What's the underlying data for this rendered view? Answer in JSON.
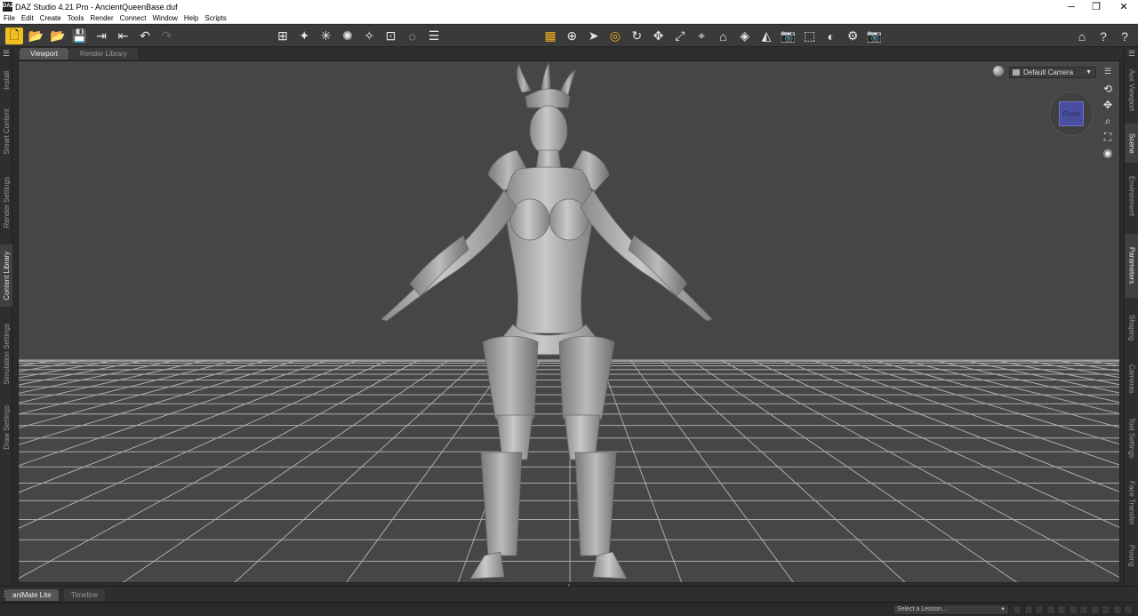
{
  "window": {
    "title": "DAZ Studio 4.21 Pro - AncientQueenBase.duf",
    "app_icon": "DAZ",
    "minimize": "─",
    "restore": "❐",
    "close": "✕"
  },
  "menu": [
    "File",
    "Edit",
    "Create",
    "Tools",
    "Render",
    "Connect",
    "Window",
    "Help",
    "Scripts"
  ],
  "toolbar": {
    "file_tools": [
      {
        "icon": "new-file-icon",
        "glyph": "🗋"
      },
      {
        "icon": "open-folder-icon",
        "glyph": "📂"
      },
      {
        "icon": "merge-folder-icon",
        "glyph": "📂"
      },
      {
        "icon": "save-icon",
        "glyph": "💾"
      },
      {
        "icon": "import-icon",
        "glyph": "⇥"
      },
      {
        "icon": "export-icon",
        "glyph": "⇤"
      },
      {
        "icon": "undo-icon",
        "glyph": "↶"
      },
      {
        "icon": "redo-icon",
        "glyph": "↷"
      }
    ],
    "create_tools": [
      {
        "icon": "create-primitive-icon",
        "glyph": "⊞"
      },
      {
        "icon": "spotlight-icon",
        "glyph": "✦"
      },
      {
        "icon": "distant-light-icon",
        "glyph": "✳"
      },
      {
        "icon": "point-light-icon",
        "glyph": "✺"
      },
      {
        "icon": "light-wand-icon",
        "glyph": "✧"
      },
      {
        "icon": "camera-create-icon",
        "glyph": "⊡"
      },
      {
        "icon": "null-node-icon",
        "glyph": "◌"
      },
      {
        "icon": "align-icon",
        "glyph": "☰"
      }
    ],
    "scene_tools": [
      {
        "icon": "scene-grid-icon",
        "glyph": "▦"
      },
      {
        "icon": "universal-tool-icon",
        "glyph": "⊕"
      },
      {
        "icon": "select-tool-icon",
        "glyph": "➤"
      },
      {
        "icon": "active-pose-icon",
        "glyph": "◎"
      },
      {
        "icon": "rotate-icon",
        "glyph": "↻"
      },
      {
        "icon": "translate-icon",
        "glyph": "✥"
      },
      {
        "icon": "scale-icon",
        "glyph": "⤢"
      },
      {
        "icon": "joint-editor-icon",
        "glyph": "⌖"
      },
      {
        "icon": "node-weight-icon",
        "glyph": "⌂"
      },
      {
        "icon": "surface-selection-icon",
        "glyph": "◈"
      },
      {
        "icon": "geometry-editor-icon",
        "glyph": "◭"
      },
      {
        "icon": "spot-render-icon",
        "glyph": "📷"
      },
      {
        "icon": "region-nav-icon",
        "glyph": "⬚"
      },
      {
        "icon": "light-tool-icon",
        "glyph": "◐"
      },
      {
        "icon": "render-settings-icon",
        "glyph": "⚙"
      },
      {
        "icon": "render-icon",
        "glyph": "📷"
      }
    ],
    "right_tools": [
      {
        "icon": "home-icon",
        "glyph": "⌂"
      },
      {
        "icon": "whats-this-icon",
        "glyph": "?"
      },
      {
        "icon": "help-icon",
        "glyph": "?"
      }
    ]
  },
  "left_tabs": [
    "Install",
    "Smart Content",
    "Render Settings",
    "Content Library",
    "Simulation Settings",
    "Draw Settings"
  ],
  "right_tabs": [
    "Aux Viewport",
    "Scene",
    "Environment",
    "Parameters",
    "Shaping",
    "Cameras",
    "Tool Settings",
    "Face Transfer",
    "Posing"
  ],
  "view_tabs": [
    "Viewport",
    "Render Library"
  ],
  "viewport": {
    "camera": "Default Camera",
    "cube_face": "Front"
  },
  "bottom_tabs": [
    "aniMate Lite",
    "Timeline"
  ],
  "status": {
    "lesson_placeholder": "Select a Lesson..."
  }
}
